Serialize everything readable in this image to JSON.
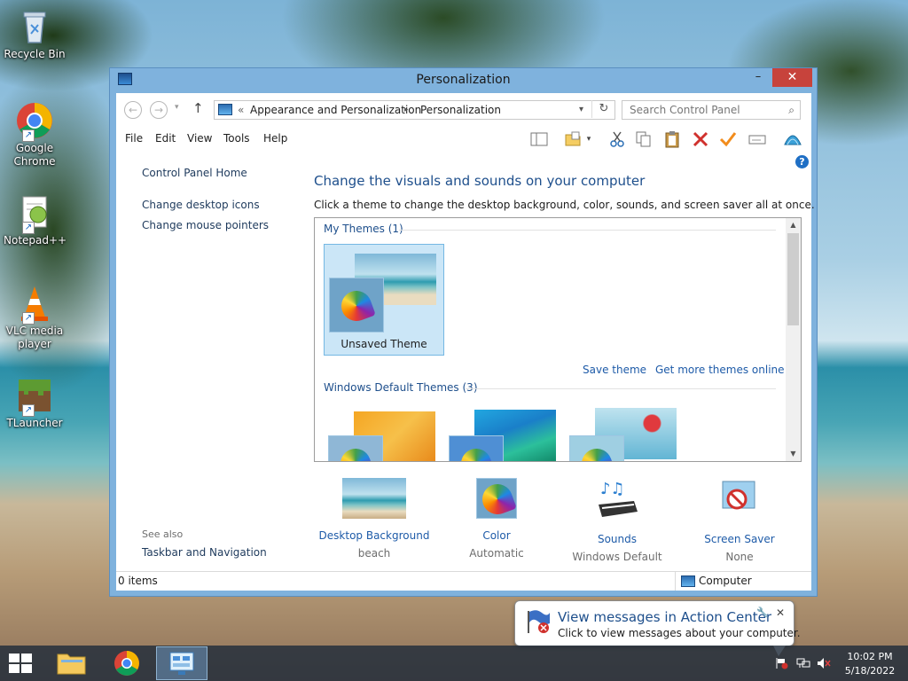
{
  "desktop": {
    "icons": [
      {
        "label": "Recycle Bin"
      },
      {
        "label": "Google Chrome"
      },
      {
        "label": "Notepad++"
      },
      {
        "label": "VLC media player"
      },
      {
        "label": "TLauncher"
      }
    ]
  },
  "window": {
    "title": "Personalization",
    "address": {
      "prefix": "«",
      "crumbs": [
        "Appearance and Personalization",
        "Personalization"
      ],
      "separator": "▸"
    },
    "search": {
      "placeholder": "Search Control Panel"
    },
    "menu": [
      "File",
      "Edit",
      "View",
      "Tools",
      "Help"
    ],
    "left_pane": {
      "links": [
        "Control Panel Home",
        "Change desktop icons",
        "Change mouse pointers"
      ],
      "see_also_label": "See also",
      "see_also_links": [
        "Taskbar and Navigation"
      ]
    },
    "main": {
      "title": "Change the visuals and sounds on your computer",
      "subtitle": "Click a theme to change the desktop background, color, sounds, and screen saver all at once.",
      "my_themes": {
        "heading": "My Themes (1)",
        "items": [
          {
            "label": "Unsaved Theme",
            "selected": true
          }
        ],
        "save_link": "Save theme",
        "more_link": "Get more themes online"
      },
      "default_themes": {
        "heading": "Windows Default Themes (3)"
      },
      "settings": [
        {
          "label": "Desktop Background",
          "value": "beach"
        },
        {
          "label": "Color",
          "value": "Automatic"
        },
        {
          "label": "Sounds",
          "value": "Windows Default"
        },
        {
          "label": "Screen Saver",
          "value": "None"
        }
      ]
    },
    "status": {
      "items": "0 items",
      "location": "Computer"
    }
  },
  "notification": {
    "title": "View messages in Action Center",
    "text": "Click to view messages about your computer."
  },
  "taskbar": {
    "clock_time": "10:02 PM",
    "clock_date": "5/18/2022"
  }
}
